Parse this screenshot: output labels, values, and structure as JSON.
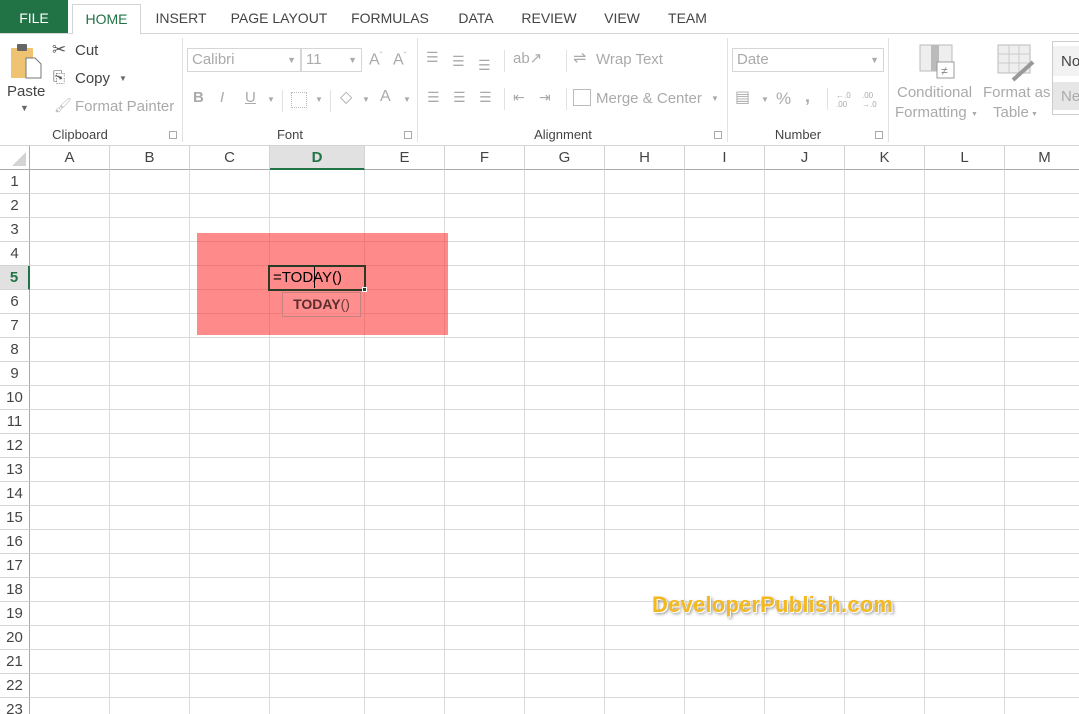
{
  "tabs": [
    {
      "label": "FILE"
    },
    {
      "label": "HOME"
    },
    {
      "label": "INSERT"
    },
    {
      "label": "PAGE LAYOUT"
    },
    {
      "label": "FORMULAS"
    },
    {
      "label": "DATA"
    },
    {
      "label": "REVIEW"
    },
    {
      "label": "VIEW"
    },
    {
      "label": "TEAM"
    }
  ],
  "active_tab": "HOME",
  "ribbon": {
    "clipboard": {
      "label": "Clipboard",
      "paste": "Paste",
      "cut": "Cut",
      "copy": "Copy",
      "format_painter": "Format Painter"
    },
    "font": {
      "label": "Font",
      "font_name": "Calibri",
      "font_size": "11",
      "bold": "B",
      "italic": "I",
      "underline": "U",
      "font_color": "A"
    },
    "alignment": {
      "label": "Alignment",
      "wrap_text": "Wrap Text",
      "merge_center": "Merge & Center"
    },
    "number": {
      "label": "Number",
      "format": "Date",
      "percent": "%",
      "comma": ",",
      "inc_decimal": "←.0 .00",
      "dec_decimal": ".00 →.0"
    },
    "styles": {
      "conditional_formatting_line1": "Conditional",
      "conditional_formatting_line2": "Formatting",
      "format_as_table_line1": "Format as",
      "format_as_table_line2": "Table",
      "style_normal": "No",
      "style_neutral": "Ne"
    }
  },
  "sheet": {
    "columns": [
      "A",
      "B",
      "C",
      "D",
      "E",
      "F",
      "G",
      "H",
      "I",
      "J",
      "K",
      "L",
      "M"
    ],
    "rows": [
      "1",
      "2",
      "3",
      "4",
      "5",
      "6",
      "7",
      "8",
      "9",
      "10",
      "11",
      "12",
      "13",
      "14",
      "15",
      "16",
      "17",
      "18",
      "19",
      "20",
      "21",
      "22",
      "23"
    ],
    "selected_column": "D",
    "selected_row": "5",
    "active_cell_value": "=TODAY()",
    "autocomplete_bold": "TODAY",
    "autocomplete_rest": "()",
    "highlight_color": "#ff5a5a"
  },
  "watermark": "DeveloperPublish.com",
  "colors": {
    "accent": "#217346"
  }
}
